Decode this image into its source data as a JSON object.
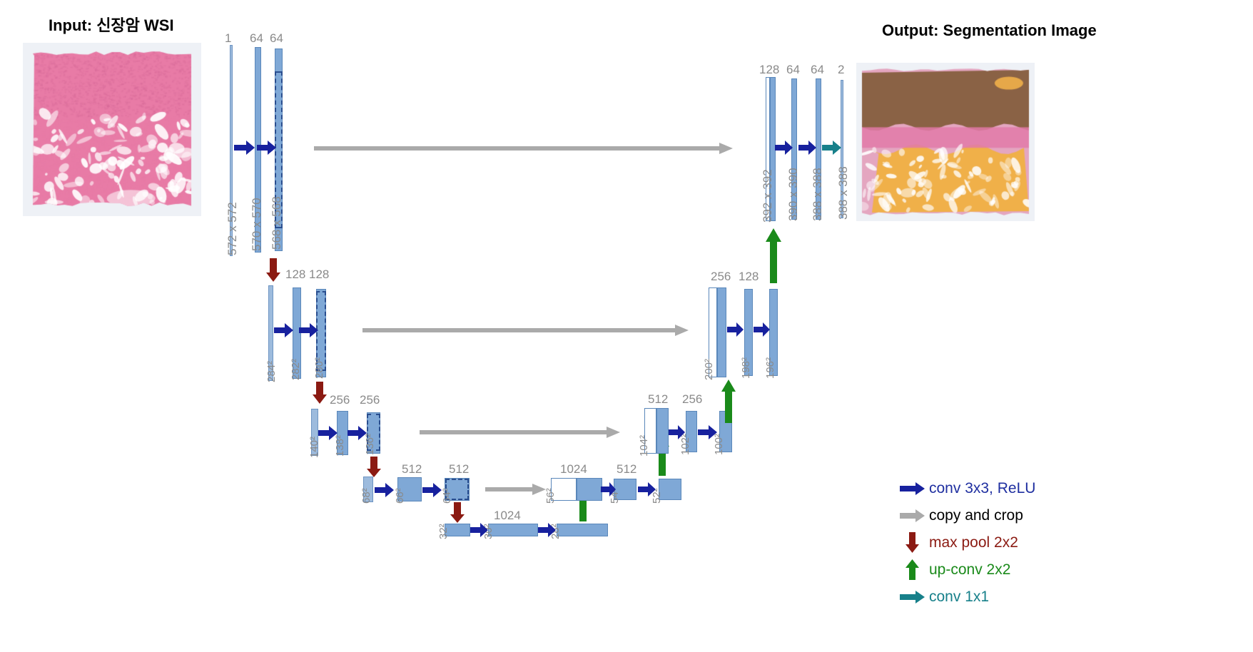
{
  "figure": {
    "type": "u-net-architecture-diagram",
    "input_title": "Input: 신장암 WSI",
    "output_title": "Output: Segmentation Image"
  },
  "colors": {
    "conv_arrow": "#17219e",
    "copy_arrow": "#aaaaaa",
    "pool_arrow": "#8b1a12",
    "upconv_arrow": "#1a8a1a",
    "conv1x1_arrow": "#17808a",
    "bar_fill": "#7fa8d6",
    "bar_stroke": "#5a87ba",
    "label_gray": "#8a8a8a"
  },
  "encoder": [
    {
      "level": 1,
      "bars": [
        {
          "channels": "1",
          "size": "572 x 572"
        },
        {
          "channels": "64",
          "size": "570 x 570"
        },
        {
          "channels": "64",
          "size": "568 x 568"
        }
      ]
    },
    {
      "level": 2,
      "bars": [
        {
          "channels": "",
          "size": "284²"
        },
        {
          "channels": "128",
          "size": "282²"
        },
        {
          "channels": "128",
          "size": "280²"
        }
      ]
    },
    {
      "level": 3,
      "bars": [
        {
          "channels": "",
          "size": "140²"
        },
        {
          "channels": "256",
          "size": "138²"
        },
        {
          "channels": "256",
          "size": "136²"
        }
      ]
    },
    {
      "level": 4,
      "bars": [
        {
          "channels": "",
          "size": "68²"
        },
        {
          "channels": "512",
          "size": "66²"
        },
        {
          "channels": "512",
          "size": "64²"
        }
      ]
    },
    {
      "level": 5,
      "bars": [
        {
          "channels": "",
          "size": "32²"
        },
        {
          "channels": "1024",
          "size": "30²"
        },
        {
          "channels": "",
          "size": "28²"
        }
      ]
    }
  ],
  "decoder": [
    {
      "level": 5,
      "bars": [
        {
          "channels": "1024",
          "size": "56²"
        },
        {
          "channels": "512",
          "size": "54²"
        },
        {
          "channels": "",
          "size": "52²"
        }
      ]
    },
    {
      "level": 4,
      "bars": [
        {
          "channels": "512",
          "size": "104²"
        },
        {
          "channels": "256",
          "size": "102²"
        },
        {
          "channels": "",
          "size": "100²"
        }
      ]
    },
    {
      "level": 3,
      "bars": [
        {
          "channels": "256",
          "size": "200²"
        },
        {
          "channels": "128",
          "size": "198²"
        },
        {
          "channels": "",
          "size": "196²"
        }
      ]
    },
    {
      "level": 1,
      "bars": [
        {
          "channels": "128",
          "size": "392 x 392"
        },
        {
          "channels": "64",
          "size": "390 x 390"
        },
        {
          "channels": "64",
          "size": "388 x 388"
        },
        {
          "channels": "2",
          "size": "388 x 388"
        }
      ]
    }
  ],
  "legend": [
    {
      "icon": "right-arrow-navy",
      "label": "conv 3x3, ReLU"
    },
    {
      "icon": "right-arrow-gray",
      "label": "copy and crop"
    },
    {
      "icon": "down-arrow-darkred",
      "label": "max pool 2x2"
    },
    {
      "icon": "up-arrow-green",
      "label": "up-conv 2x2"
    },
    {
      "icon": "right-arrow-teal",
      "label": "conv 1x1"
    }
  ]
}
